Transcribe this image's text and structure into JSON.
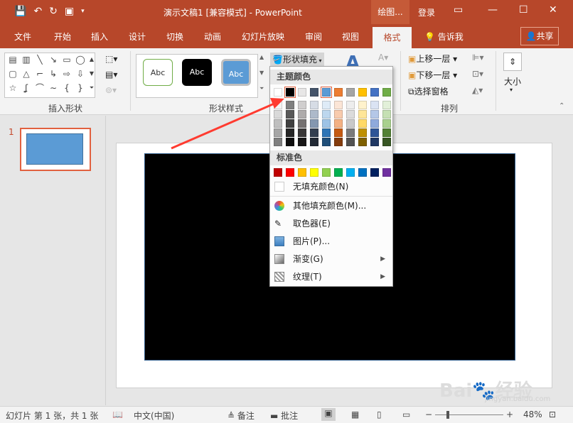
{
  "title_bar": {
    "doc_title": "演示文稿1 [兼容模式] - PowerPoint",
    "drawing_tools": "绘图...",
    "login": "登录"
  },
  "tabs": [
    "文件",
    "开始",
    "插入",
    "设计",
    "切换",
    "动画",
    "幻灯片放映",
    "审阅",
    "视图",
    "格式",
    "告诉我"
  ],
  "active_tab": "格式",
  "share_label": "共享",
  "ribbon": {
    "group_insert_shapes": "插入形状",
    "group_shape_styles": "形状样式",
    "group_arrange": "排列",
    "style_abc": "Abc",
    "shape_fill_label": "形状填充",
    "bring_forward": "上移一层",
    "send_backward": "下移一层",
    "selection_pane": "选择窗格",
    "size_label": "大小"
  },
  "dropdown": {
    "theme_colors_label": "主题颜色",
    "standard_colors_label": "标准色",
    "theme_top_row": [
      "#ffffff",
      "#000000",
      "#e7e6e6",
      "#44546a",
      "#5b9bd5",
      "#ed7d31",
      "#a5a5a5",
      "#ffc000",
      "#4472c4",
      "#70ad47"
    ],
    "theme_shades": [
      [
        "#f2f2f2",
        "#808080",
        "#d0cece",
        "#d6dce5",
        "#deebf7",
        "#fbe5d6",
        "#ededed",
        "#fff2cc",
        "#dae3f3",
        "#e2f0d9"
      ],
      [
        "#d9d9d9",
        "#595959",
        "#aeabab",
        "#adb9ca",
        "#bdd7ee",
        "#f8cbad",
        "#dbdbdb",
        "#ffe699",
        "#b4c7e7",
        "#c5e0b4"
      ],
      [
        "#bfbfbf",
        "#404040",
        "#757171",
        "#8497b0",
        "#9dc3e6",
        "#f4b183",
        "#c9c9c9",
        "#ffd966",
        "#8faadc",
        "#a9d18e"
      ],
      [
        "#a6a6a6",
        "#262626",
        "#3a3838",
        "#333f50",
        "#2e75b6",
        "#c55a11",
        "#7b7b7b",
        "#bf9000",
        "#2f5597",
        "#538135"
      ],
      [
        "#808080",
        "#0d0d0d",
        "#171616",
        "#222a35",
        "#1f4e79",
        "#843c0c",
        "#525252",
        "#7f6000",
        "#203864",
        "#375623"
      ]
    ],
    "standard_colors": [
      "#c00000",
      "#ff0000",
      "#ffc000",
      "#ffff00",
      "#92d050",
      "#00b050",
      "#00b0f0",
      "#0070c0",
      "#002060",
      "#7030a0"
    ],
    "no_fill": "无填充颜色(N)",
    "more_colors": "其他填充颜色(M)...",
    "eyedropper": "取色器(E)",
    "picture": "图片(P)...",
    "gradient": "渐变(G)",
    "texture": "纹理(T)"
  },
  "thumbnail": {
    "slide_number": "1"
  },
  "status_bar": {
    "slide_info": "幻灯片 第 1 张，共 1 张",
    "language": "中文(中国)",
    "notes": "备注",
    "comments": "批注",
    "zoom": "48%"
  },
  "watermark": {
    "brand": "Bai🐾经验",
    "url": "jingyan.baidu.com"
  },
  "colors": {
    "brand": "#b7472a",
    "accent_orange": "#e1613f",
    "shape_blue": "#5b9bd5"
  }
}
